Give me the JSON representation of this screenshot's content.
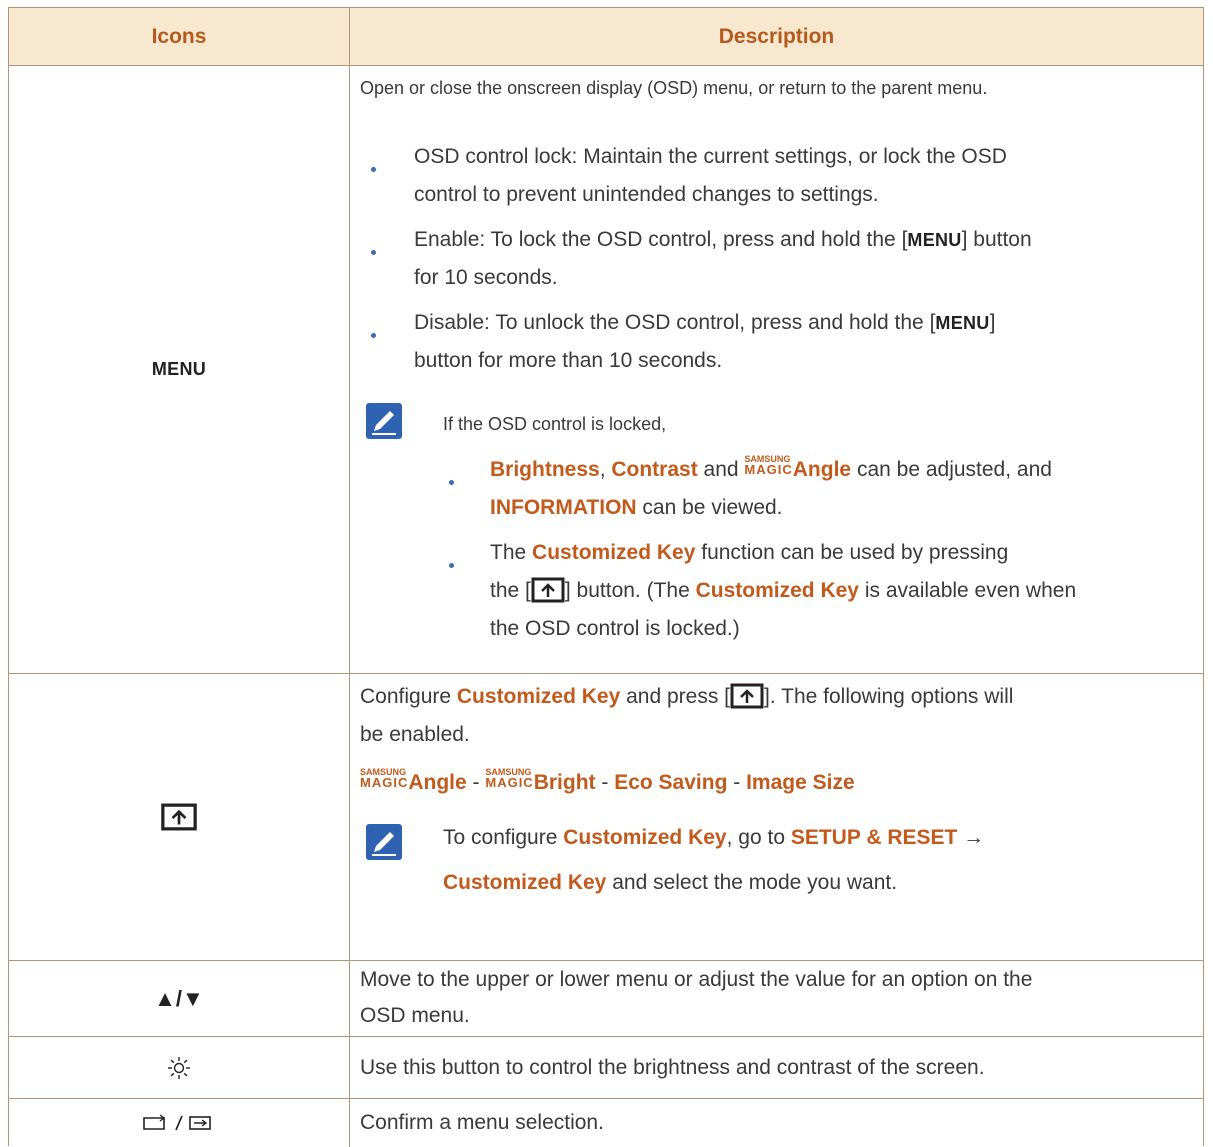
{
  "header": {
    "col_icons": "Icons",
    "col_description": "Description"
  },
  "row_menu": {
    "icon_label": "MENU",
    "intro": "Open or close the onscreen display (OSD) menu, or return to the parent menu.",
    "b1_l1": "OSD control lock: Maintain the current settings, or lock the OSD",
    "b1_l2": "control to prevent unintended changes to settings.",
    "b2_l1_a": "Enable: To lock the OSD control, press and hold the [",
    "b2_l1_key": "MENU",
    "b2_l1_b": "] button",
    "b2_l2": "for 10 seconds.",
    "b3_l1_a": "Disable: To unlock the OSD control, press and hold the [",
    "b3_l1_key": "MENU",
    "b3_l1_b": "]",
    "b3_l2": "button for more than 10 seconds.",
    "note_intro": "If the OSD control is locked,",
    "n1_brightness": "Brightness",
    "n1_comma": ", ",
    "n1_contrast": "Contrast",
    "n1_and": " and ",
    "magic_top": "SAMSUNG",
    "magic_bot": "MAGIC",
    "n1_angle": "Angle",
    "n1_rest": " can be adjusted, and",
    "n1_information": "INFORMATION",
    "n1_viewed": " can be viewed.",
    "n2_l1_a": "The ",
    "n2_l1_key": "Customized Key",
    "n2_l1_b": " function can be used by pressing",
    "n2_l2_a": "the [",
    "n2_l2_b": "] button. (The ",
    "n2_l2_key": "Customized Key",
    "n2_l2_c": " is available even when",
    "n2_l3": "the OSD control is locked.)"
  },
  "row_custom": {
    "l1_a": "Configure ",
    "l1_key": "Customized Key",
    "l1_b": " and press [",
    "l1_c": "]. The following options will",
    "l2": "be enabled.",
    "opt_angle": "Angle",
    "sep": " - ",
    "opt_bright": "Bright",
    "opt_eco": "Eco Saving",
    "opt_image": "Image Size",
    "note_a": "To configure ",
    "note_key": "Customized Key",
    "note_b": ", go to ",
    "note_setup": "SETUP & RESET",
    "note_arrow": "  →",
    "note_key2": "Customized Key",
    "note_c": " and select the mode you want."
  },
  "row_updown": {
    "icon_label": "▲/▼",
    "l1": "Move to the upper or lower menu or adjust the value for an option on the",
    "l2": "OSD menu."
  },
  "row_brightness": {
    "l1": "Use this button to control the brightness and contrast of the screen."
  },
  "row_confirm": {
    "l1": "Confirm a menu selection."
  }
}
